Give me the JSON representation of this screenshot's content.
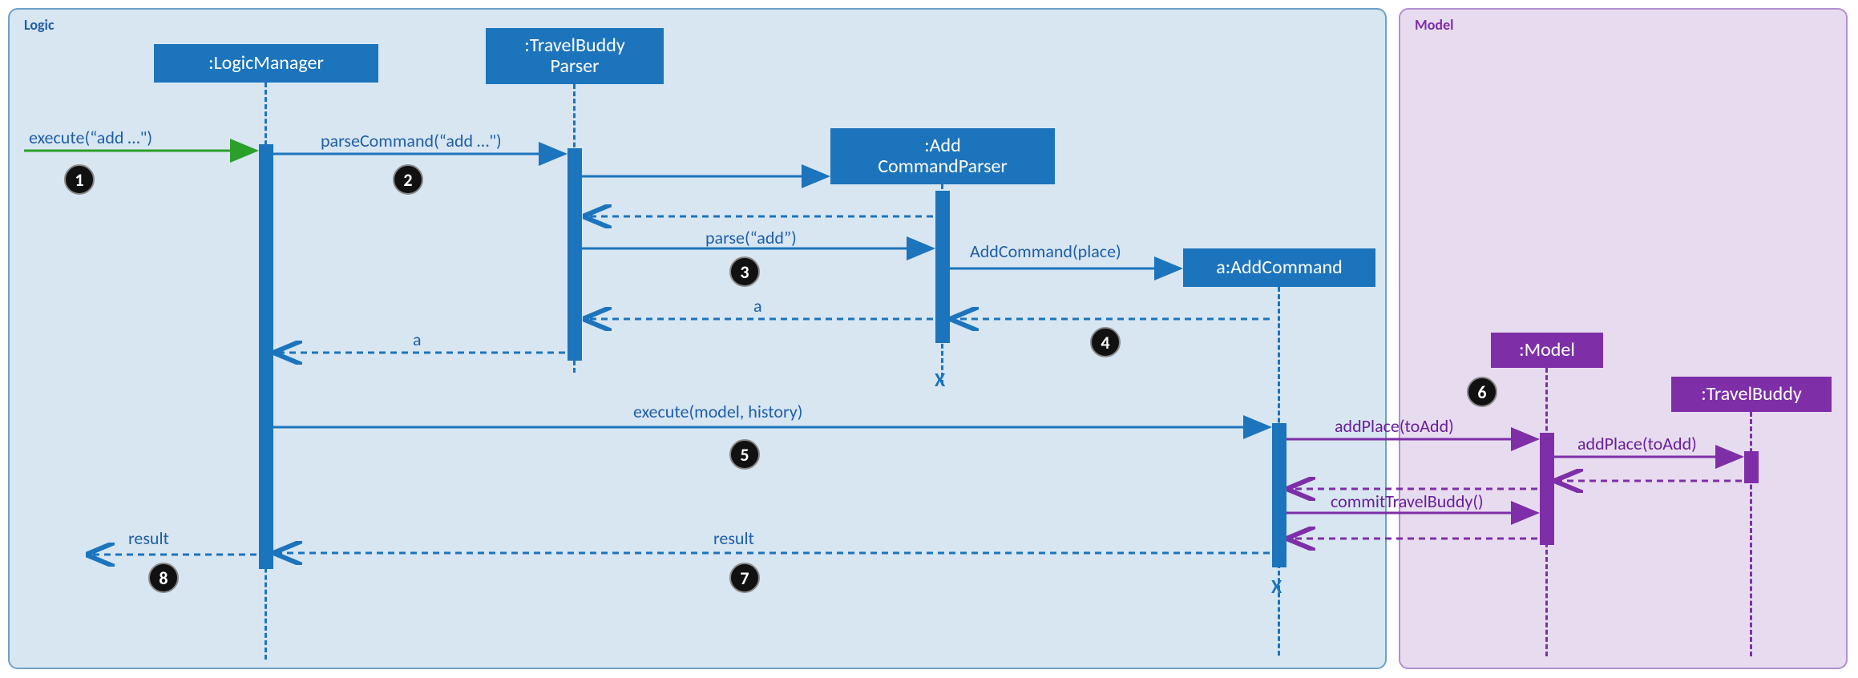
{
  "panels": {
    "logic": {
      "title": "Logic"
    },
    "model": {
      "title": "Model"
    }
  },
  "lifelines": {
    "logicManager": ":LogicManager",
    "travelBuddyParser": ":TravelBuddy\nParser",
    "addCommandParser": ":Add\nCommandParser",
    "addCommand": "a:AddCommand",
    "model": ":Model",
    "travelBuddy": ":TravelBuddy"
  },
  "steps": {
    "s1": "1",
    "s2": "2",
    "s3": "3",
    "s4": "4",
    "s5": "5",
    "s6": "6",
    "s7": "7",
    "s8": "8"
  },
  "messages": {
    "execute1": "execute(“add …\")",
    "parseCommand": "parseCommand(“add …\")",
    "parse": "parse(“add”)",
    "addCommandPlace": "AddCommand(place)",
    "returnA1": "a",
    "returnA2": "a",
    "executeModel": "execute(model, history)",
    "addPlace1": "addPlace(toAdd)",
    "addPlace2": "addPlace(toAdd)",
    "commit": "commitTravelBuddy()",
    "result1": "result",
    "result2": "result"
  },
  "x_marks": {
    "x1": "X",
    "x2": "X"
  }
}
